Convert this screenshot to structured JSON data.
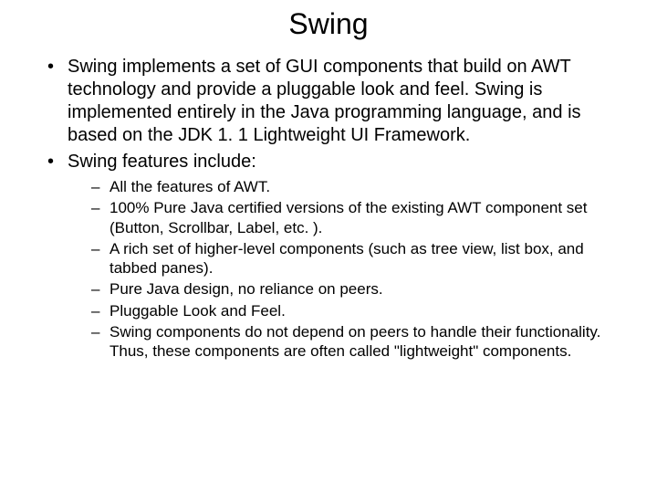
{
  "title": "Swing",
  "bullets": [
    {
      "text": "Swing implements a set of GUI components that build on AWT technology and provide a pluggable look and feel. Swing is implemented entirely in the Java programming language, and is based on the JDK 1. 1 Lightweight UI Framework."
    },
    {
      "text": "Swing features include:",
      "sub": [
        "All the features of AWT.",
        "100% Pure Java certified versions of the existing AWT component set (Button, Scrollbar, Label, etc. ).",
        "A rich set of higher-level components (such as tree view, list box, and tabbed panes).",
        "Pure Java design, no reliance on peers.",
        "Pluggable Look and Feel.",
        "Swing components do not depend on peers to handle their functionality. Thus, these components are often called \"lightweight\" components."
      ]
    }
  ]
}
